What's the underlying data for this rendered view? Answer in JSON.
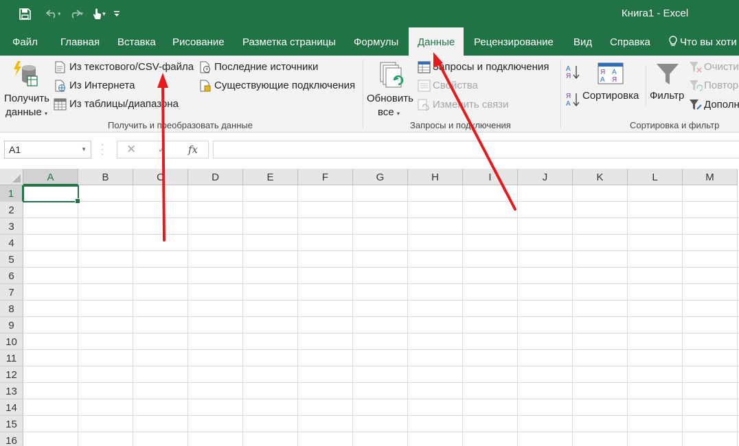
{
  "window": {
    "title": "Книга1  -  Excel"
  },
  "quick_access": {
    "icons": [
      "save-icon",
      "undo-icon",
      "redo-icon",
      "touch-mode-icon",
      "customize-icon"
    ]
  },
  "tabs": [
    {
      "label": "Файл",
      "active": false
    },
    {
      "label": "Главная",
      "active": false
    },
    {
      "label": "Вставка",
      "active": false
    },
    {
      "label": "Рисование",
      "active": false
    },
    {
      "label": "Разметка страницы",
      "active": false
    },
    {
      "label": "Формулы",
      "active": false
    },
    {
      "label": "Данные",
      "active": true
    },
    {
      "label": "Рецензирование",
      "active": false
    },
    {
      "label": "Вид",
      "active": false
    },
    {
      "label": "Справка",
      "active": false
    },
    {
      "label": "Что вы хоти",
      "active": false
    }
  ],
  "ribbon": {
    "get_data": {
      "button_line1": "Получить",
      "button_line2": "данные",
      "from_text_csv": "Из текстового/CSV-файла",
      "from_web": "Из Интернета",
      "from_table": "Из таблицы/диапазона",
      "recent_sources": "Последние источники",
      "existing_connections": "Существующие подключения",
      "group_label": "Получить и преобразовать данные"
    },
    "queries": {
      "refresh_line1": "Обновить",
      "refresh_line2": "все",
      "queries_connections": "Запросы и подключения",
      "properties": "Свойства",
      "edit_links": "Изменить связи",
      "group_label": "Запросы и подключения"
    },
    "sort_filter": {
      "sort": "Сортировка",
      "filter": "Фильтр",
      "clear": "Очисти",
      "reapply": "Повтор",
      "advanced": "Дополн",
      "group_label": "Сортировка и фильтр"
    }
  },
  "formula_bar": {
    "name_box": "A1",
    "fx_label": "fx",
    "formula": ""
  },
  "sheet": {
    "columns": [
      "A",
      "B",
      "C",
      "D",
      "E",
      "F",
      "G",
      "H",
      "I",
      "J",
      "K",
      "L",
      "M"
    ],
    "rows": [
      "1",
      "2",
      "3",
      "4",
      "5",
      "6",
      "7",
      "8",
      "9",
      "10",
      "11",
      "12",
      "13",
      "14",
      "15",
      "16"
    ],
    "active_cell": "A1"
  },
  "colors": {
    "excel_green": "#217346",
    "arrow_red": "#e8191b"
  }
}
